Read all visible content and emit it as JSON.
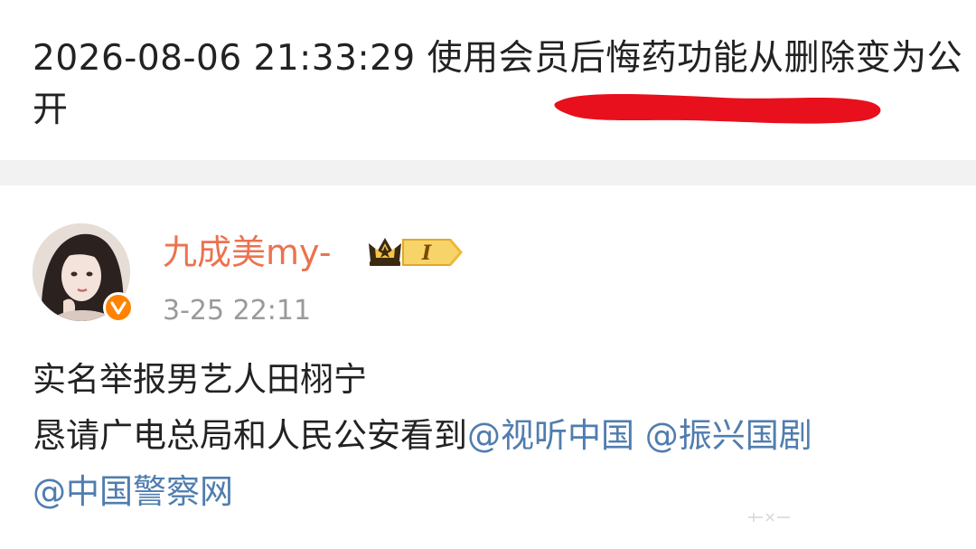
{
  "history": {
    "text": "2026-08-06 21:33:29 使用会员后悔药功能从删除变为公开"
  },
  "post": {
    "author": {
      "name": "九成美my-",
      "level_badge": "I"
    },
    "timestamp": "3-25 22:11",
    "body": {
      "line1": "实名举报男艺人田栩宁",
      "line2_prefix": "恳请广电总局和人民公安看到",
      "mentions": [
        "@视听中国",
        "@振兴国剧",
        "@中国警察网"
      ]
    }
  },
  "colors": {
    "username": "#eb7350",
    "mention": "#507daf",
    "verified": "#ff8200",
    "redline": "#e8101c",
    "divider": "#f2f2f2"
  },
  "icons": {
    "verified": "verified-v-icon",
    "crown": "crown-icon"
  }
}
